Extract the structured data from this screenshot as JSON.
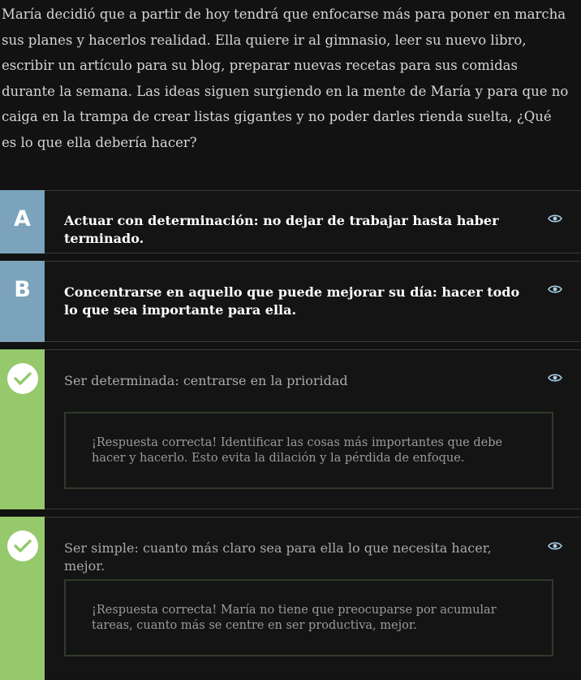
{
  "question": "María decidió que a partir de hoy tendrá que enfocarse más para poner en marcha sus planes y hacerlos realidad. Ella quiere ir al gimnasio, leer su nuevo libro, escribir un artículo para su blog, preparar nuevas recetas para sus comidas durante la semana. Las ideas siguen surgiendo en la mente de María y para que no caiga en la trampa de crear listas gigantes y no poder darles rienda suelta, ¿Qué es lo que ella debería hacer?",
  "options": [
    {
      "badge": "A",
      "text": "Actuar con determinación: no dejar de trabajar hasta haber terminado.",
      "state": "unselected",
      "icon": "eye-icon"
    },
    {
      "badge": "B",
      "text": "Concentrarse en aquello que puede mejorar su día: hacer todo lo que sea importante para ella.",
      "state": "unselected",
      "icon": "eye-icon"
    },
    {
      "badge": "check-icon",
      "text": "Ser determinada: centrarse en la prioridad",
      "state": "correct",
      "icon": "eye-icon",
      "feedback": "¡Respuesta correcta! Identificar las cosas más importantes que debe hacer y hacerlo. Esto evita la dilación y la pérdida de enfoque."
    },
    {
      "badge": "check-icon",
      "text": "Ser simple: cuanto más claro sea para ella lo que necesita hacer, mejor.",
      "state": "correct",
      "icon": "eye-icon",
      "feedback": "¡Respuesta correcta! María no tiene que preocuparse por acumular tareas, cuanto más se centre en ser productiva, mejor."
    }
  ],
  "colors": {
    "background": "#121212",
    "letter_badge": "#7ba3bb",
    "correct_badge": "#95c96b",
    "eye_icon": "#a9cfe6",
    "check": "#95c96b"
  }
}
